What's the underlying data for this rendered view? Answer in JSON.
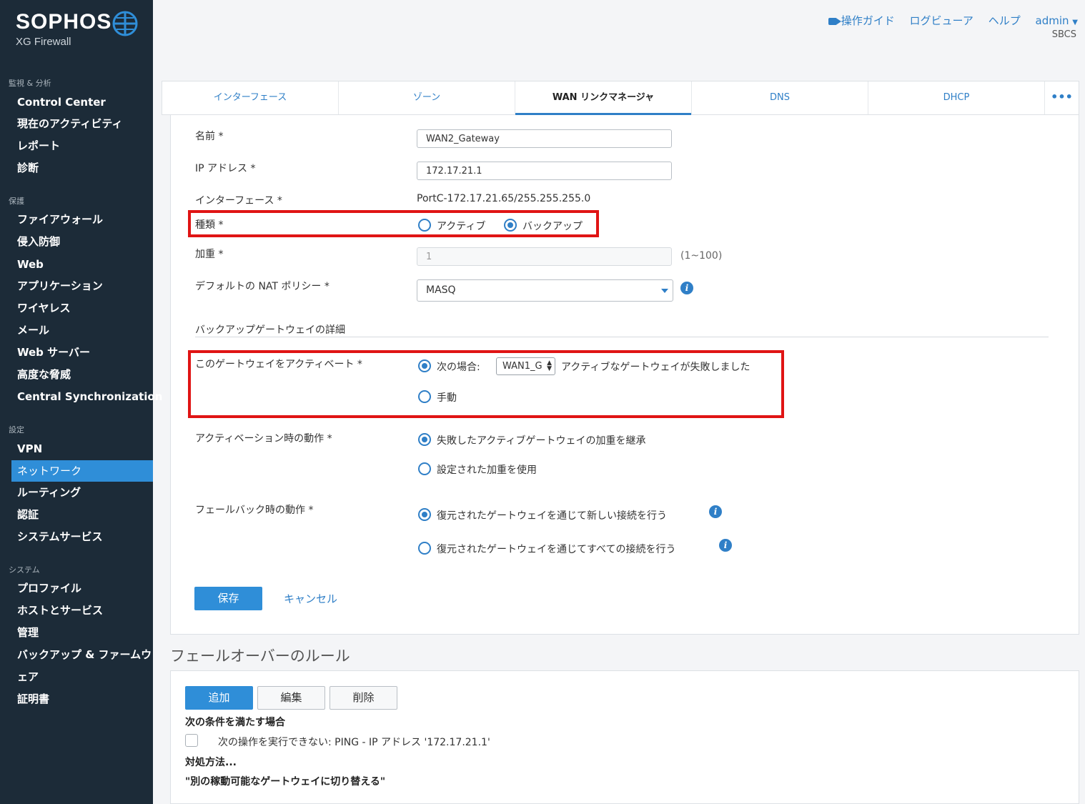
{
  "brand": {
    "name": "SOPHOS",
    "product": "XG Firewall"
  },
  "header": {
    "links": [
      "操作ガイド",
      "ログビューア",
      "ヘルプ",
      "admin"
    ],
    "sub": "SBCS"
  },
  "sidebar": {
    "sections": [
      {
        "title": "監視 & 分析",
        "items": [
          "Control Center",
          "現在のアクティビティ",
          "レポート",
          "診断"
        ]
      },
      {
        "title": "保護",
        "items": [
          "ファイアウォール",
          "侵入防御",
          "Web",
          "アプリケーション",
          "ワイヤレス",
          "メール",
          "Web サーバー",
          "高度な脅威",
          "Central Synchronization"
        ]
      },
      {
        "title": "設定",
        "items": [
          "VPN",
          "ネットワーク",
          "ルーティング",
          "認証",
          "システムサービス"
        ]
      },
      {
        "title": "システム",
        "items": [
          "プロファイル",
          "ホストとサービス",
          "管理",
          "バックアップ & ファームウ",
          "ェア",
          "証明書"
        ]
      }
    ],
    "active": "ネットワーク"
  },
  "tabs": [
    "インターフェース",
    "ゾーン",
    "WAN リンクマネージャ",
    "DNS",
    "DHCP",
    "•••"
  ],
  "form": {
    "name_label": "名前 *",
    "name_value": "WAN2_Gateway",
    "ip_label": "IP アドレス *",
    "ip_value": "172.17.21.1",
    "iface_label": "インターフェース *",
    "iface_value": "PortC-172.17.21.65/255.255.255.0",
    "type_label": "種類 *",
    "type_options": [
      "アクティブ",
      "バックアップ"
    ],
    "type_selected": "バックアップ",
    "weight_label": "加重 *",
    "weight_value": "1",
    "weight_range": "(1~100)",
    "nat_label": "デフォルトの NAT ポリシー *",
    "nat_value": "MASQ",
    "backup_section": "バックアップゲートウェイの詳細",
    "activate_label": "このゲートウェイをアクティベート *",
    "activate_option1": "次の場合:",
    "activate_gateway": "WAN1_G",
    "activate_option1_suffix": "アクティブなゲートウェイが失敗しました",
    "activate_option2": "手動",
    "on_activation_label": "アクティベーション時の動作 *",
    "on_activation_options": [
      "失敗したアクティブゲートウェイの加重を継承",
      "設定された加重を使用"
    ],
    "failback_label": "フェールバック時の動作 *",
    "failback_options": [
      "復元されたゲートウェイを通じて新しい接続を行う",
      "復元されたゲートウェイを通じてすべての接続を行う"
    ],
    "save": "保存",
    "cancel": "キャンセル"
  },
  "failover": {
    "title": "フェールオーバーのルール",
    "buttons": [
      "追加",
      "編集",
      "削除"
    ],
    "condition_heading": "次の条件を満たす場合",
    "rule_text": "次の操作を実行できない: PING - IP アドレス '172.17.21.1'",
    "action_heading": "対処方法...",
    "action_text": "\"別の稼動可能なゲートウェイに切り替える\""
  },
  "colors": {
    "sidebar": "#1c2b38",
    "accent": "#2f8ed8",
    "highlight": "#e01414"
  }
}
